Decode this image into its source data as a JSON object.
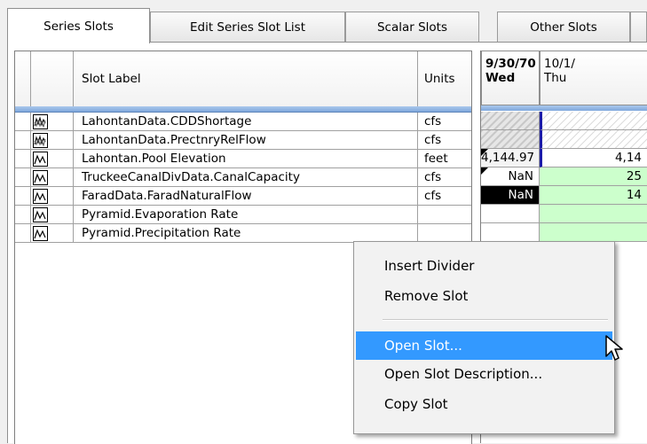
{
  "tabs": [
    {
      "label": "Series Slots",
      "active": true
    },
    {
      "label": "Edit Series Slot List",
      "active": false
    },
    {
      "label": "Scalar Slots",
      "active": false
    },
    {
      "label": "Other Slots",
      "active": false
    }
  ],
  "slot_table": {
    "columns": {
      "label": "Slot Label",
      "units": "Units"
    },
    "rows": [
      {
        "label": "LahontanData.CDDShortage",
        "units": "cfs",
        "icon": "multi-series-slot-icon"
      },
      {
        "label": "LahontanData.PrectnryRelFlow",
        "units": "cfs",
        "icon": "multi-series-slot-icon"
      },
      {
        "label": "Lahontan.Pool Elevation",
        "units": "feet",
        "icon": "series-slot-icon"
      },
      {
        "label": "TruckeeCanalDivData.CanalCapacity",
        "units": "cfs",
        "icon": "series-slot-icon"
      },
      {
        "label": "FaradData.FaradNaturalFlow",
        "units": "cfs",
        "icon": "series-slot-icon"
      },
      {
        "label": "Pyramid.Evaporation Rate",
        "units": "",
        "icon": "series-slot-icon"
      },
      {
        "label": "Pyramid.Precipitation Rate",
        "units": "",
        "icon": "series-slot-icon"
      }
    ]
  },
  "date_grid": {
    "columns": [
      {
        "date": "9/30/70",
        "day": "Wed"
      },
      {
        "date": "10/1/",
        "day": "Thu"
      }
    ],
    "values": [
      [
        "",
        ""
      ],
      [
        "",
        ""
      ],
      [
        "4,144.97",
        "4,14"
      ],
      [
        "NaN",
        "25"
      ],
      [
        "NaN",
        "14"
      ],
      [
        "",
        ""
      ],
      [
        "",
        ""
      ]
    ]
  },
  "context_menu": {
    "items": [
      {
        "label": "Insert Divider",
        "highlighted": false
      },
      {
        "label": "Remove Slot",
        "highlighted": false
      },
      {
        "label": "Open Slot...",
        "highlighted": true
      },
      {
        "label": "Open Slot Description...",
        "highlighted": false
      },
      {
        "label": "Copy Slot",
        "highlighted": false
      }
    ]
  },
  "colors": {
    "highlight": "#3399ff",
    "input_green": "#ccffcc",
    "selected_black": "#000000",
    "header_strip": "#a9c8ec"
  }
}
